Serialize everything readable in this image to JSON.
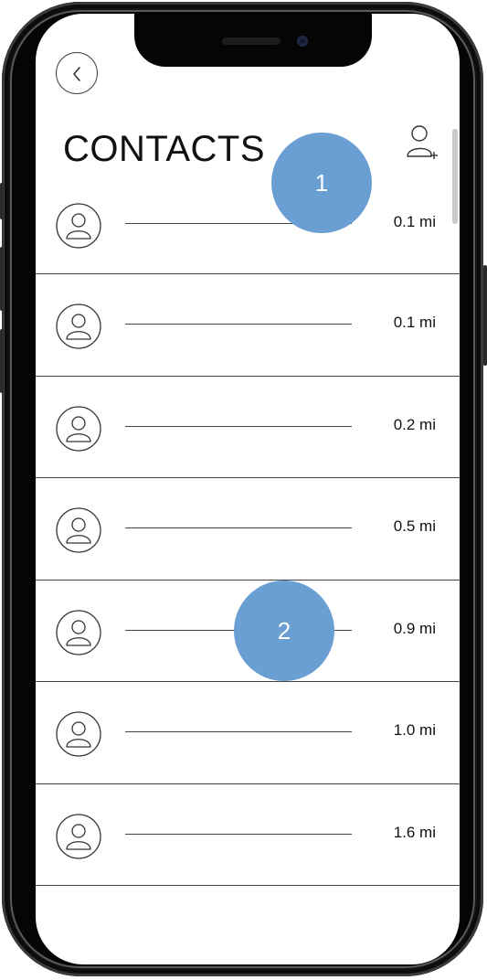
{
  "header": {
    "title": "CONTACTS"
  },
  "contacts": [
    {
      "distance": "0.1 mi"
    },
    {
      "distance": "0.1 mi"
    },
    {
      "distance": "0.2 mi"
    },
    {
      "distance": "0.5 mi"
    },
    {
      "distance": "0.9 mi"
    },
    {
      "distance": "1.0 mi"
    },
    {
      "distance": "1.6 mi"
    },
    {
      "distance": ""
    }
  ],
  "annotations": [
    {
      "label": "1"
    },
    {
      "label": "2"
    }
  ],
  "icons": {
    "back": "chevron-left-icon",
    "add_user": "add-user-icon",
    "avatar": "user-avatar-icon"
  },
  "colors": {
    "annotation_badge": "#6a9fd4",
    "frame": "#141414",
    "divider": "#444444"
  }
}
